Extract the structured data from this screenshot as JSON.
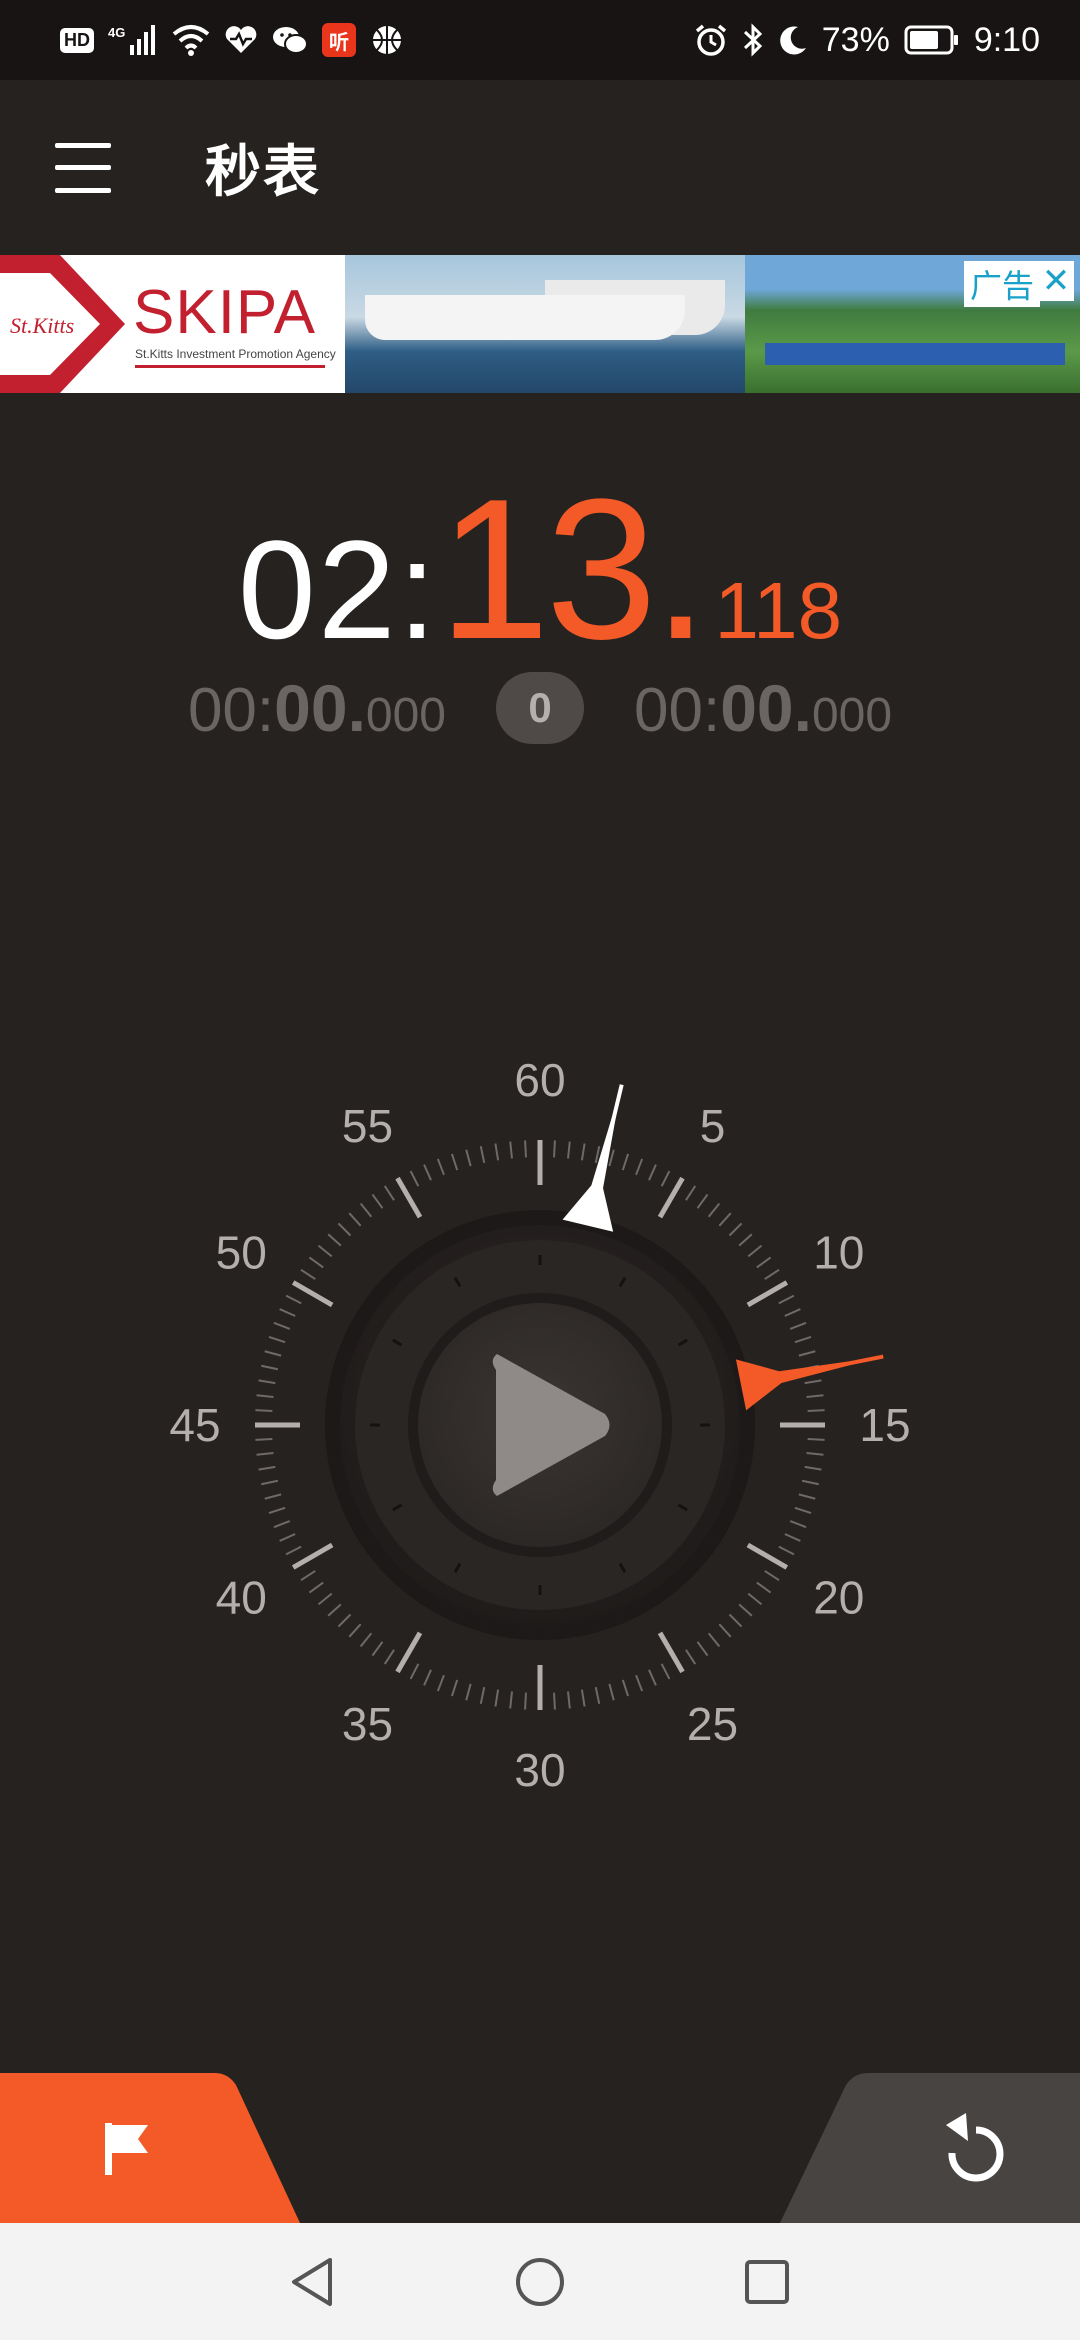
{
  "status_bar": {
    "hd_badge": "HD",
    "network": "4G",
    "app_badge": "听",
    "battery_percent": "73%",
    "time": "9:10"
  },
  "app_bar": {
    "title": "秒表"
  },
  "ad": {
    "brand": "SKIPA",
    "brand_sub": "St.Kitts Investment Promotion Agency",
    "label": "广告",
    "close": "✕"
  },
  "stopwatch": {
    "minutes": "02:",
    "seconds": "13.",
    "millis": "118"
  },
  "laps": {
    "lap_time": {
      "minutes": "00:",
      "seconds": "00.",
      "millis": "000"
    },
    "count": "0",
    "total_time": {
      "minutes": "00:",
      "seconds": "00.",
      "millis": "000"
    }
  },
  "dial": {
    "labels": [
      "60",
      "5",
      "10",
      "15",
      "20",
      "25",
      "30",
      "35",
      "40",
      "45",
      "50",
      "55"
    ],
    "second_hand_value": 2.25,
    "minute_hand_value": 13.12
  },
  "colors": {
    "accent": "#f45a27",
    "background": "#262220",
    "tick": "#9a9593"
  }
}
